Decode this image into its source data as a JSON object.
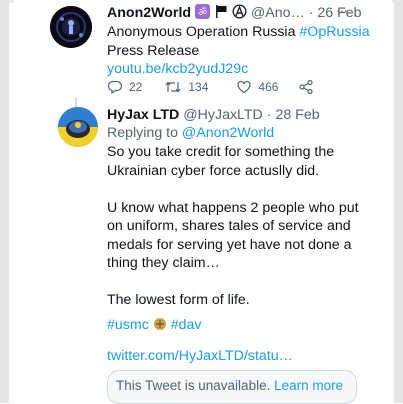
{
  "tweet1": {
    "display_name": "Anon2World",
    "handle": "@Ano…",
    "separator": "·",
    "date": "26 Feb",
    "text_line1_prefix": "Anonymous Operation Russia ",
    "hashtag": "#OpRussia",
    "text_line2": "Press Release",
    "link": "youtu.be/kcb2yudJ29c",
    "replies": "22",
    "retweets": "134",
    "likes": "466"
  },
  "tweet2": {
    "display_name": "HyJax LTD",
    "handle": "@HyJaxLTD",
    "separator": "·",
    "date": "28 Feb",
    "replying_prefix": "Replying to ",
    "replying_handle": "@Anon2World",
    "paragraphs": [
      "So you take credit for something the Ukrainian cyber force actuslly did.",
      "U know what happens 2 people who put on uniform, shares tales of service and medals for serving yet have not done a thing they claim…",
      "The lowest form of life."
    ],
    "hashtag1": "#usmc",
    "hashtag2": "#dav",
    "link": "twitter.com/HyJaxLTD/statu…",
    "unavailable_text": "This Tweet is unavailable.",
    "learn_more": "Learn more"
  },
  "icons": [
    "reply-icon",
    "retweet-icon",
    "like-icon",
    "share-icon",
    "more-icon"
  ],
  "colors": {
    "link": "#1d9bf0",
    "muted": "#536471",
    "text": "#0f1419"
  }
}
